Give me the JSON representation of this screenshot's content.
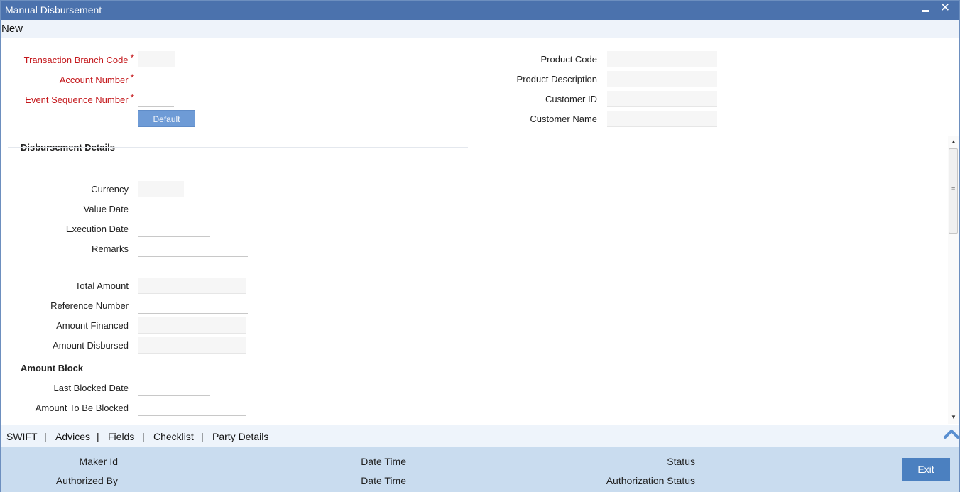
{
  "window": {
    "title": "Manual Disbursement",
    "minimize_glyph": "–",
    "close_glyph": "✕"
  },
  "menu": {
    "new_label": "New"
  },
  "header_fields": {
    "transaction_branch_code": {
      "label": "Transaction Branch Code",
      "value": ""
    },
    "account_number": {
      "label": "Account Number",
      "value": ""
    },
    "event_sequence_number": {
      "label": "Event Sequence Number",
      "value": ""
    },
    "required_mark": "*",
    "default_button": "Default",
    "product_code": {
      "label": "Product Code",
      "value": ""
    },
    "product_description": {
      "label": "Product Description",
      "value": ""
    },
    "customer_id": {
      "label": "Customer ID",
      "value": ""
    },
    "customer_name": {
      "label": "Customer Name",
      "value": ""
    }
  },
  "disbursement_details": {
    "title": "Disbursement Details",
    "currency": {
      "label": "Currency",
      "value": ""
    },
    "value_date": {
      "label": "Value Date",
      "value": ""
    },
    "execution_date": {
      "label": "Execution Date",
      "value": ""
    },
    "remarks": {
      "label": "Remarks",
      "value": ""
    },
    "total_amount": {
      "label": "Total Amount",
      "value": ""
    },
    "reference_number": {
      "label": "Reference Number",
      "value": ""
    },
    "amount_financed": {
      "label": "Amount Financed",
      "value": ""
    },
    "amount_disbursed": {
      "label": "Amount Disbursed",
      "value": ""
    }
  },
  "amount_block": {
    "title": "Amount Block",
    "last_blocked_date": {
      "label": "Last Blocked Date",
      "value": ""
    },
    "amount_to_be_blocked": {
      "label": "Amount To Be Blocked",
      "value": ""
    }
  },
  "scrollbar": {
    "up_arrow": "▲",
    "down_arrow": "▼",
    "grip": "≡"
  },
  "tabs": {
    "items": [
      "SWIFT",
      "Advices",
      "Fields",
      "Checklist",
      "Party Details"
    ],
    "separator": "|"
  },
  "audit": {
    "maker_id": "Maker Id",
    "date_time_1": "Date Time",
    "status": "Status",
    "authorized_by": "Authorized By",
    "date_time_2": "Date Time",
    "authorization_status": "Authorization Status",
    "exit_label": "Exit"
  },
  "colors": {
    "title_bar": "#4b72ad",
    "required": "#c4181c",
    "button": "#6e9bd6",
    "audit_bar": "#c9dcef",
    "exit_button": "#4b80c0"
  }
}
